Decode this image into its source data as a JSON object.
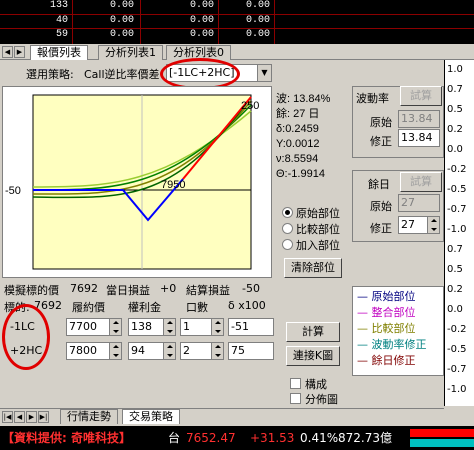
{
  "top_table": {
    "rows": [
      {
        "c1": "133",
        "c2": "0.00",
        "c3": "0.00",
        "c4": "0.00"
      },
      {
        "c1": "40",
        "c2": "0.00",
        "c3": "0.00",
        "c4": "0.00"
      },
      {
        "c1": "59",
        "c2": "0.00",
        "c3": "0.00",
        "c4": "0.00"
      }
    ]
  },
  "tabs": {
    "items": [
      "報價列表",
      "分析列表1",
      "分析列表0"
    ]
  },
  "strategy": {
    "label": "選用策略:",
    "text": "Call逆比率價差",
    "selected": "[-1LC+2HC]"
  },
  "chart": {
    "left_label": "-50",
    "right_label": "250",
    "mid_label": "7950",
    "colors": {
      "blue": "#0000ff",
      "red": "#ff0000",
      "green": "#008000",
      "yellowgreen": "#9acd32",
      "olive": "#808000",
      "bg": "#ffffc0"
    }
  },
  "chart_data": {
    "type": "line",
    "title": "",
    "xlabel": "",
    "ylabel": "",
    "series": [
      {
        "name": "原始部位",
        "color": "#0000ff",
        "shape": "payoff-at-expiry",
        "points": [
          [
            -1,
            -50
          ],
          [
            7800,
            -150
          ],
          [
            7950,
            -50
          ]
        ]
      },
      {
        "name": "餘日修正",
        "color": "#ff0000",
        "shape": "payoff-after-break-even",
        "points": [
          [
            7950,
            -50
          ],
          [
            8100,
            250
          ]
        ]
      }
    ]
  },
  "stats": {
    "vol_label": "波:",
    "vol_value": "13.84%",
    "days_label": "餘:",
    "days_value": "27 日",
    "delta_label": "δ:",
    "delta_value": "0.2459",
    "gamma_label": "Υ:",
    "gamma_value": "0.0012",
    "vega_label": "ν:",
    "vega_value": "8.5594",
    "theta_label": "Θ:",
    "theta_value": "-1.9914"
  },
  "positions": {
    "radio1": "原始部位",
    "radio2": "比較部位",
    "radio3": "加入部位",
    "clear_button": "清除部位"
  },
  "volatility": {
    "title": "波動率",
    "calc_button": "試算",
    "orig_label": "原始",
    "orig_value": "13.84",
    "adj_label": "修正",
    "adj_value": "13.84"
  },
  "days": {
    "title": "餘日",
    "calc_button": "試算",
    "orig_label": "原始",
    "orig_value": "27",
    "adj_label": "修正",
    "adj_value": "27"
  },
  "legend": {
    "items": [
      {
        "text": "原始部位",
        "color": "#000080"
      },
      {
        "text": "整合部位",
        "color": "#c000c0"
      },
      {
        "text": "比較部位",
        "color": "#808000"
      },
      {
        "text": "波動率修正",
        "color": "#008080"
      },
      {
        "text": "餘日修正",
        "color": "#800000"
      }
    ]
  },
  "sim": {
    "underlying_label": "模擬標的價",
    "underlying_value": "7692",
    "daily_pnl_label": "當日損益",
    "daily_pnl_value": "+0",
    "settle_pnl_label": "結算損益",
    "settle_pnl_value": "-50",
    "underlying2_label": "標的:",
    "underlying2_value": "7692",
    "col_strike": "履約價",
    "col_premium": "權利金",
    "col_qty": "口數",
    "col_delta": "δ x100"
  },
  "legs": [
    {
      "name": "-1LC",
      "strike": "7700",
      "premium": "138",
      "qty": "1",
      "delta": "-51"
    },
    {
      "name": "+2HC",
      "strike": "7800",
      "premium": "94",
      "qty": "2",
      "delta": "75"
    }
  ],
  "actions": {
    "calc": "計算",
    "chart_link": "連接K圖",
    "structure": "構成",
    "distribution": "分佈圖"
  },
  "right_axis": {
    "ticks": [
      "1.0",
      "0.7",
      "0.5",
      "0.2",
      "0.0",
      "-0.2",
      "-0.5",
      "-0.7",
      "-1.0",
      "0.7",
      "0.5",
      "0.2",
      "0.0",
      "-0.2",
      "-0.5",
      "-0.7",
      "-1.0"
    ]
  },
  "bottom_tabs": {
    "tab1": "行情走勢",
    "tab2": "交易策略"
  },
  "status": {
    "provider": "【資料提供: 奇唯科技】",
    "market": "台",
    "price": "7652.47",
    "change": "+31.53",
    "pct": "0.41%",
    "volume": "872.73億"
  }
}
